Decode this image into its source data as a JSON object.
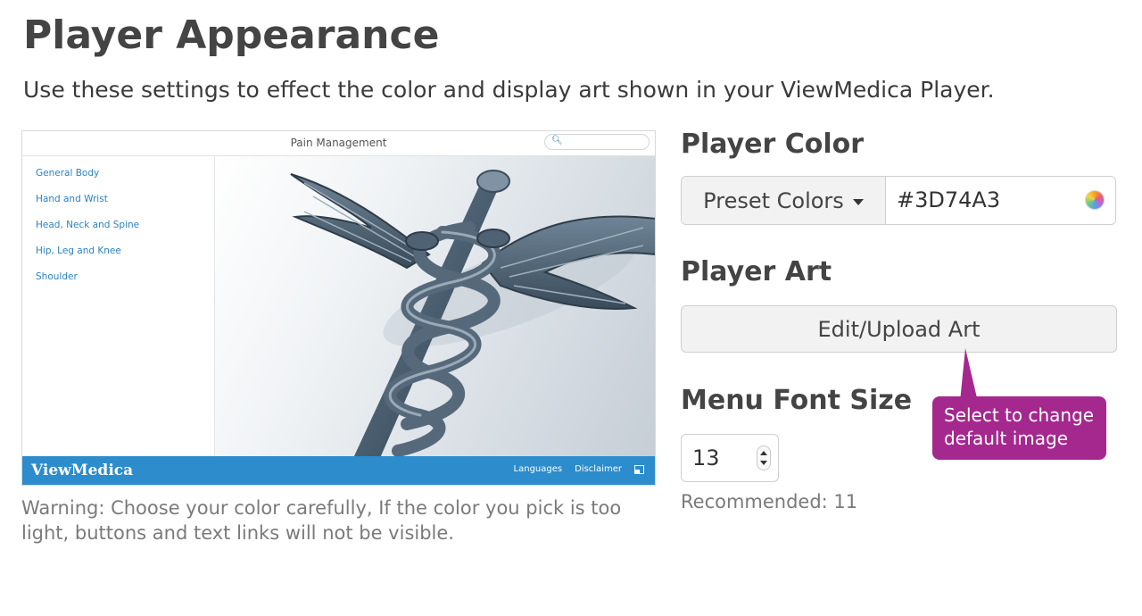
{
  "page": {
    "title": "Player Appearance",
    "description": "Use these settings to effect the color and display art shown in your ViewMedica Player."
  },
  "preview": {
    "title": "Pain Management",
    "search_icon": "search-icon",
    "menu_items": [
      "General Body",
      "Hand and Wrist",
      "Head, Neck and Spine",
      "Hip, Leg and Knee",
      "Shoulder"
    ],
    "brand": "ViewMedica",
    "footer_links": [
      "Languages",
      "Disclaimer"
    ],
    "footer_icon": "fullscreen-icon",
    "footer_color": "#2c8ccc",
    "art": "caduceus"
  },
  "warning": "Warning: Choose your color carefully, If the color you pick is too light, buttons and text links will not be visible.",
  "player_color": {
    "heading": "Player Color",
    "preset_label": "Preset Colors",
    "hex_value": "#3D74A3",
    "picker_icon": "color-wheel-icon"
  },
  "player_art": {
    "heading": "Player Art",
    "button_label": "Edit/Upload Art"
  },
  "tooltip": {
    "text": "Select to change default image",
    "color": "#a5288f"
  },
  "menu_font": {
    "heading": "Menu Font Size",
    "value": "13",
    "recommended": "Recommended: 11"
  }
}
